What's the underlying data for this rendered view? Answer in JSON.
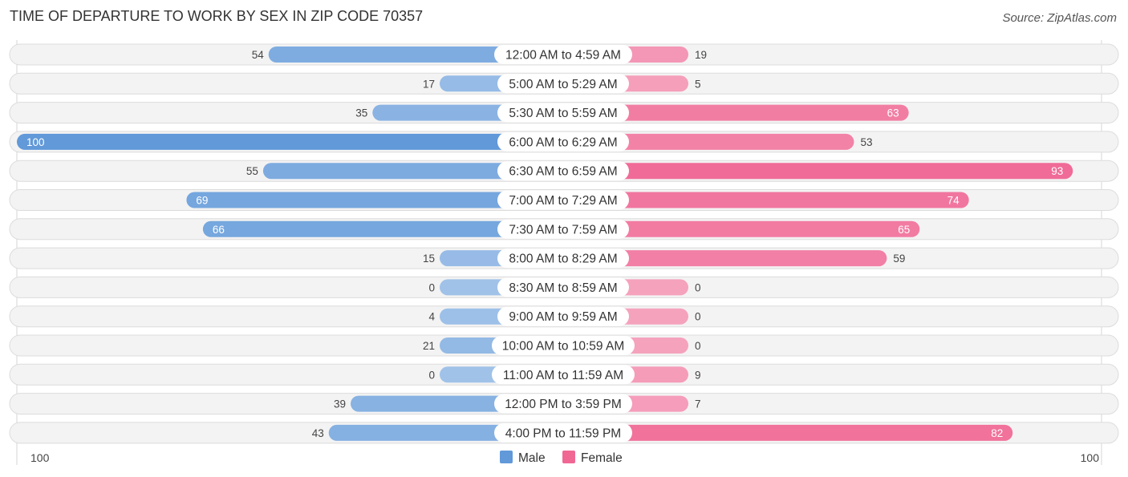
{
  "header": {
    "title": "TIME OF DEPARTURE TO WORK BY SEX IN ZIP CODE 70357",
    "source": "Source: ZipAtlas.com"
  },
  "colors": {
    "male_strong": "#6199d9",
    "male_light": "#a7c6ea",
    "female_strong": "#f06794",
    "female_light": "#f6a8c1"
  },
  "chart_data": {
    "type": "bar",
    "orientation": "horizontal-diverging",
    "title": "TIME OF DEPARTURE TO WORK BY SEX IN ZIP CODE 70357",
    "xlabel": "",
    "ylabel": "",
    "xlim": [
      -100,
      100
    ],
    "axis_labels": {
      "left": "100",
      "right": "100"
    },
    "legend": {
      "position": "bottom-center",
      "entries": [
        "Male",
        "Female"
      ]
    },
    "categories": [
      "12:00 AM to 4:59 AM",
      "5:00 AM to 5:29 AM",
      "5:30 AM to 5:59 AM",
      "6:00 AM to 6:29 AM",
      "6:30 AM to 6:59 AM",
      "7:00 AM to 7:29 AM",
      "7:30 AM to 7:59 AM",
      "8:00 AM to 8:29 AM",
      "8:30 AM to 8:59 AM",
      "9:00 AM to 9:59 AM",
      "10:00 AM to 10:59 AM",
      "11:00 AM to 11:59 AM",
      "12:00 PM to 3:59 PM",
      "4:00 PM to 11:59 PM"
    ],
    "series": [
      {
        "name": "Male",
        "values": [
          54,
          17,
          35,
          100,
          55,
          69,
          66,
          15,
          0,
          4,
          21,
          0,
          39,
          43
        ]
      },
      {
        "name": "Female",
        "values": [
          19,
          5,
          63,
          53,
          93,
          74,
          65,
          59,
          0,
          0,
          0,
          9,
          7,
          82
        ]
      }
    ]
  }
}
